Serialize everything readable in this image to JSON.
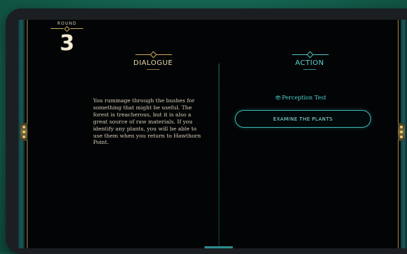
{
  "round": {
    "label": "ROUND",
    "number": "3"
  },
  "dialogue": {
    "title": "DIALOGUE",
    "text": "You rummage through the bushes for something that might be useful. The forest is treacherous, but it is also a great source of raw materials. If you identify any plants, you will be able to use them when you return to Hawthorn Point."
  },
  "action": {
    "title": "ACTION",
    "skill_check": "Perception Test",
    "skill_icon": "eye-icon",
    "button_label": "EXAMINE THE PLANTS"
  },
  "colors": {
    "background": "#15624f",
    "screen": "#030405",
    "gold": "#c9a85a",
    "teal": "#3db7b8"
  }
}
